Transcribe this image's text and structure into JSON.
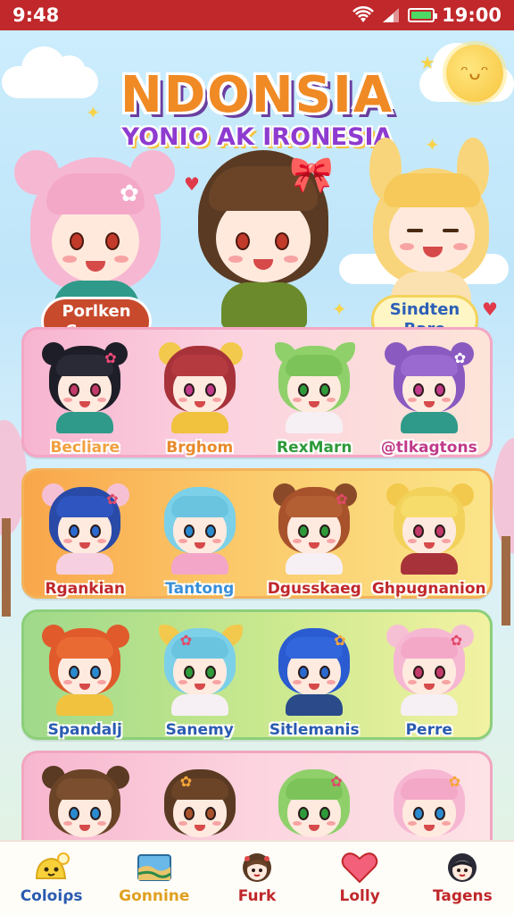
{
  "status_bar": {
    "time_left": "9:48",
    "time_right": "19:00"
  },
  "header": {
    "title": "NDONSIA",
    "subtitle": "YONIO AK IRONESIA"
  },
  "hero_buttons": {
    "left": {
      "line1": "Porlken",
      "line2": "Craags"
    },
    "right": {
      "line1": "Sindten",
      "line2": "Bare"
    }
  },
  "grid": {
    "rows": [
      {
        "cards": [
          {
            "name": "Becliare",
            "name_color": "#f0a040"
          },
          {
            "name": "Brghom",
            "name_color": "#e88a2c"
          },
          {
            "name": "RexMarn",
            "name_color": "#2e9a3a"
          },
          {
            "name": "@tlkagtons",
            "name_color": "#c03a8a"
          }
        ]
      },
      {
        "cards": [
          {
            "name": "Rgankian",
            "name_color": "#c0282b"
          },
          {
            "name": "Tantong",
            "name_color": "#3a8fd8"
          },
          {
            "name": "Dgusskaeg",
            "name_color": "#c0282b"
          },
          {
            "name": "Ghpugnanion",
            "name_color": "#c0282b"
          }
        ]
      },
      {
        "cards": [
          {
            "name": "Spandalj",
            "name_color": "#2a5bb0"
          },
          {
            "name": "Sanemy",
            "name_color": "#2a5bb0"
          },
          {
            "name": "Sitlemanis",
            "name_color": "#2a5bb0"
          },
          {
            "name": "Perre",
            "name_color": "#2a5bb0"
          }
        ]
      },
      {
        "cards": [
          {
            "name": "",
            "name_color": "#2a5bb0"
          },
          {
            "name": "",
            "name_color": "#2a5bb0"
          },
          {
            "name": "",
            "name_color": "#2a5bb0"
          },
          {
            "name": "",
            "name_color": "#2a5bb0"
          }
        ]
      }
    ]
  },
  "bottom_nav": {
    "items": [
      {
        "label": "Coloiρs",
        "icon": "slime-chat-icon",
        "color": "#2a5bb0"
      },
      {
        "label": "Gonnine",
        "icon": "map-icon",
        "color": "#e0a020"
      },
      {
        "label": "Furk",
        "icon": "avatar-icon",
        "color": "#c0282b"
      },
      {
        "label": "Lolly",
        "icon": "heart-icon",
        "color": "#c0282b"
      },
      {
        "label": "Tagens",
        "icon": "avatar-icon",
        "color": "#c0282b"
      }
    ]
  }
}
